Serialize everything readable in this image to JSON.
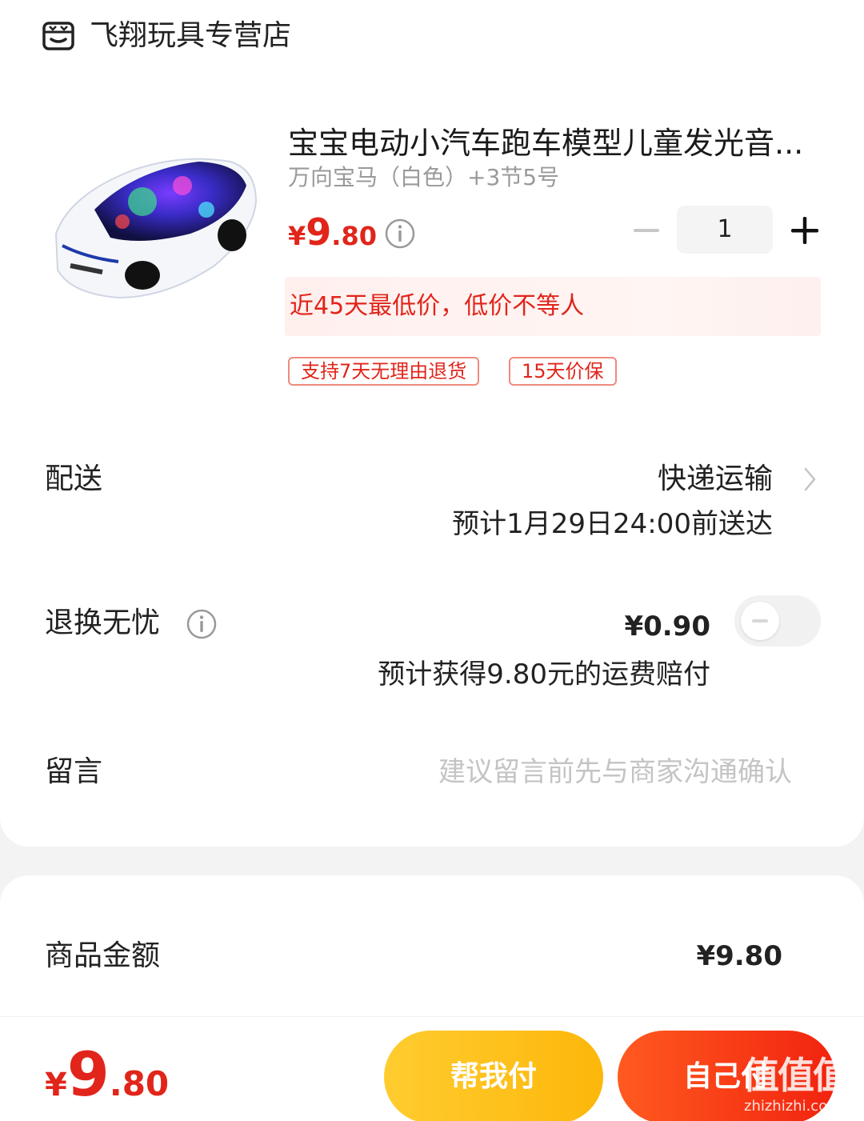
{
  "store": {
    "name": "飞翔玩具专营店",
    "icon": "store-icon"
  },
  "product": {
    "title": "宝宝电动小汽车跑车模型儿童发光音...",
    "spec": "万向宝马（白色）+3节5号",
    "price_currency": "¥",
    "price_int": "9",
    "price_dec": ".80",
    "quantity": "1",
    "lowest_price_note": "近45天最低价，低价不等人",
    "tags": [
      "支持7天无理由退货",
      "15天价保"
    ]
  },
  "delivery": {
    "label": "配送",
    "method": "快递运输",
    "eta": "预计1月29日24:00前送达"
  },
  "return_insurance": {
    "label": "退换无忧",
    "price": "¥0.90",
    "compensation": "预计获得9.80元的运费赔付",
    "enabled": false
  },
  "message": {
    "label": "留言",
    "placeholder": "建议留言前先与商家沟通确认"
  },
  "subtotal": {
    "label": "商品金额",
    "value": "¥9.80"
  },
  "footer": {
    "total_currency": "¥",
    "total_int": "9",
    "total_dec": ".80",
    "help_pay_label": "帮我付",
    "self_pay_label": "自己付"
  },
  "watermark": {
    "text": "值值值",
    "url": "zhizhizhi.com"
  },
  "colors": {
    "accent_red": "#e1251b",
    "help_button": "#fdb70b",
    "self_button": "#f2230f"
  }
}
